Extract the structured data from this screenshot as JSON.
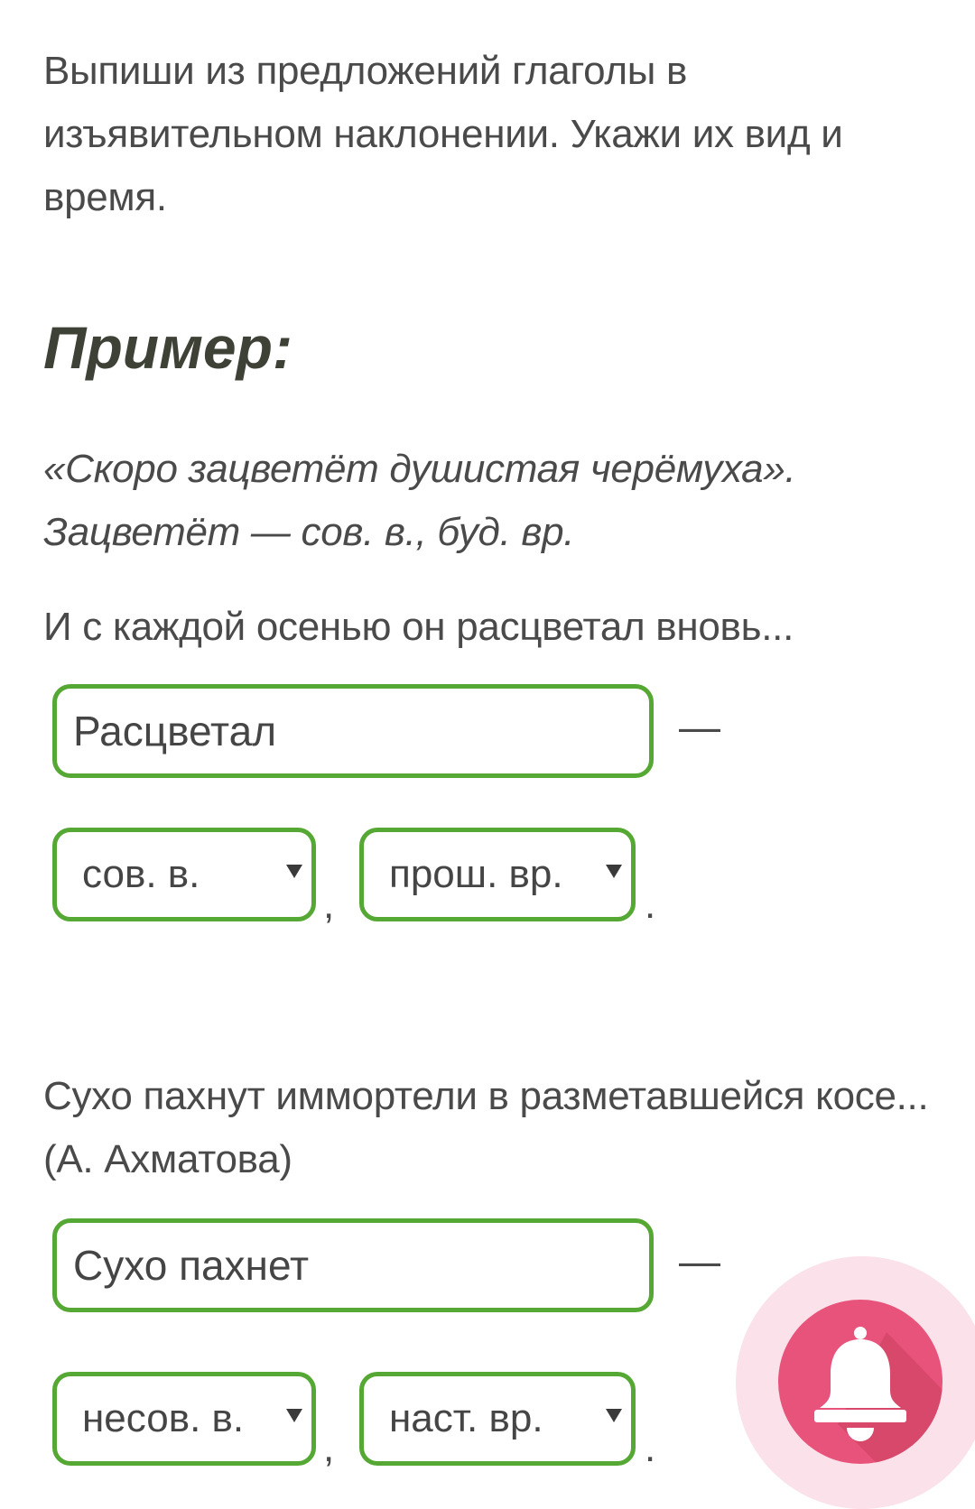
{
  "task": {
    "instruction": "Выпиши из предложений глаголы в изъявительном наклонении. Укажи их вид и время."
  },
  "example": {
    "heading": "Пример:",
    "line1": "«Скоро зацветёт душистая черёмуха».",
    "line2": "Зацветёт — сов. в., буд. вр."
  },
  "exercises": [
    {
      "sentence": "И с каждой осенью он расцветал вновь...",
      "answer": "Расцветал",
      "dash": "—",
      "aspect": "сов. в.",
      "tense": "прош. вр.",
      "comma": ",",
      "period": "."
    },
    {
      "sentence": "Сухо пахнут иммортели в разметавшейся косе... (А. Ахматова)",
      "answer": "Сухо пахнет",
      "dash": "—",
      "aspect": "несов. в.",
      "tense": "наст. вр.",
      "comma": ",",
      "period": "."
    }
  ],
  "notification_button": {
    "icon": "bell-icon",
    "color": "#e8537b"
  }
}
